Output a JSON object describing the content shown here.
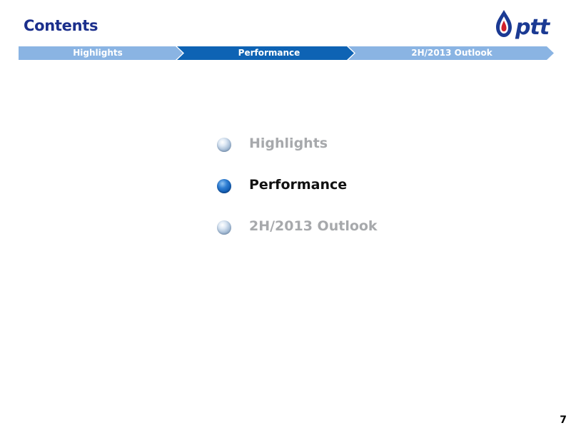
{
  "header": {
    "title": "Contents",
    "logo_text": "ptt"
  },
  "nav": {
    "items": [
      {
        "label": "Highlights",
        "active": false
      },
      {
        "label": "Performance",
        "active": true
      },
      {
        "label": "2H/2013 Outlook",
        "active": false
      }
    ]
  },
  "menu": {
    "items": [
      {
        "label": "Highlights",
        "state": "inactive"
      },
      {
        "label": "Performance",
        "state": "active"
      },
      {
        "label": "2H/2013 Outlook",
        "state": "inactive"
      }
    ]
  },
  "footer": {
    "page_number": "7"
  },
  "colors": {
    "title": "#1b2f8c",
    "nav_active": "#0e63b4",
    "nav_inactive": "#8ab4e3",
    "text_active": "#111111",
    "text_inactive": "#a7a9ac",
    "logo_blue": "#1b3a93",
    "logo_red": "#d0202a"
  },
  "icons": {
    "logo": "ptt-flame-logo",
    "bullet": "sphere-bullet-icon"
  }
}
